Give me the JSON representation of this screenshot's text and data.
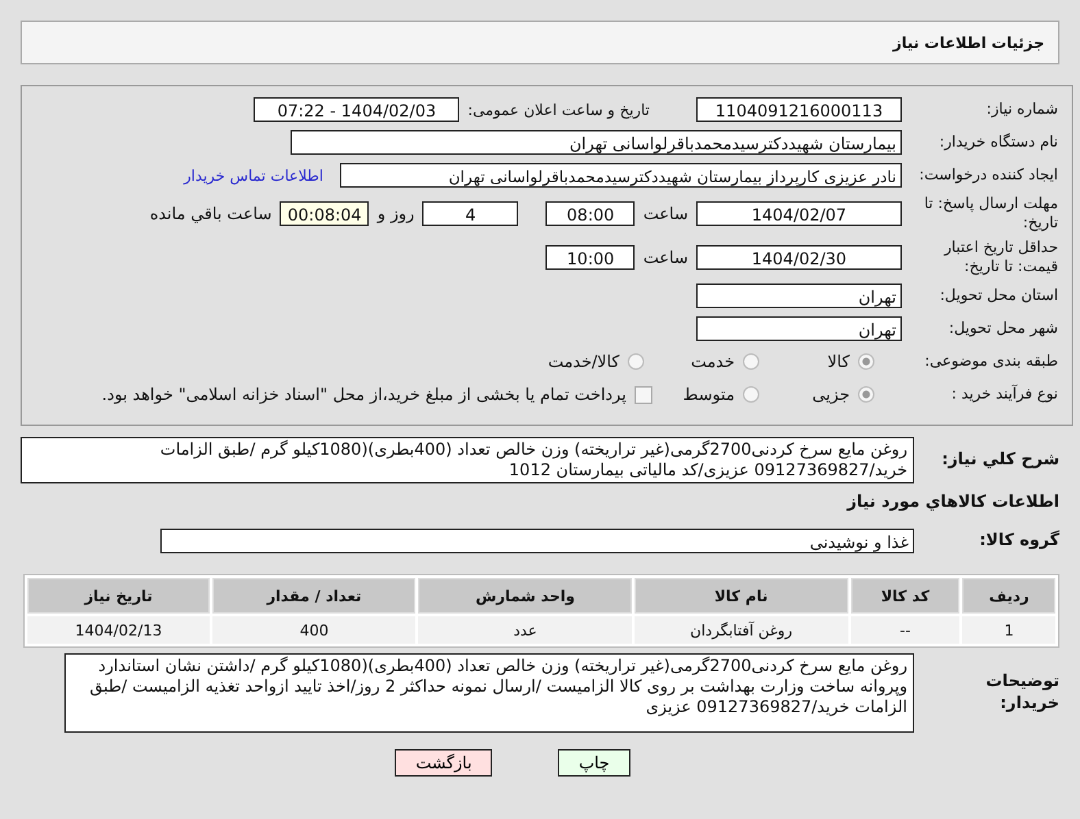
{
  "header": {
    "title": "جزئیات اطلاعات نیاز"
  },
  "form": {
    "need_number": {
      "label": "شماره نیاز:",
      "value": "1104091216000113"
    },
    "announce": {
      "label": "تاریخ و ساعت اعلان عمومی:",
      "value": "1404/02/03 - 07:22"
    },
    "buyer": {
      "label": "نام دستگاه خریدار:",
      "value": "بیمارستان شهیددکترسیدمحمدباقرلواسانی تهران"
    },
    "creator": {
      "label": "ایجاد کننده درخواست:",
      "value": "نادر  عزیزی کارپرداز بیمارستان شهیددکترسیدمحمدباقرلواسانی تهران",
      "link": "اطلاعات تماس خریدار"
    },
    "deadline": {
      "label": "مهلت ارسال پاسخ: تا تاریخ:",
      "date": "1404/02/07",
      "time_label": "ساعت",
      "time": "08:00",
      "days": "4",
      "days_label": "روز و",
      "remaining": "00:08:04",
      "remaining_label": "ساعت باقي مانده"
    },
    "validity": {
      "label": "حداقل تاریخ اعتبار قیمت: تا تاریخ:",
      "date": "1404/02/30",
      "time_label": "ساعت",
      "time": "10:00"
    },
    "province": {
      "label": "استان محل تحویل:",
      "value": "تهران"
    },
    "city": {
      "label": "شهر محل تحویل:",
      "value": "تهران"
    },
    "category": {
      "label": "طبقه بندی موضوعی:",
      "options": [
        {
          "label": "کالا",
          "selected": true
        },
        {
          "label": "خدمت",
          "selected": false
        },
        {
          "label": "کالا/خدمت",
          "selected": false
        }
      ]
    },
    "process": {
      "label": "نوع فرآیند خرید :",
      "options": [
        {
          "label": "جزیی",
          "selected": true
        },
        {
          "label": "متوسط",
          "selected": false
        }
      ],
      "payment": {
        "label": "پرداخت تمام یا بخشی از مبلغ خرید،از محل \"اسناد خزانه اسلامی\" خواهد بود.",
        "checked": false
      }
    }
  },
  "summary": {
    "label": "شرح كلي نياز:",
    "value": "روغن مایع سرخ کردنی2700گرمی(غیر تراریخته) وزن خالص تعداد (400بطری)(1080کیلو گرم /طبق الزامات خرید/09127369827 عزیزی/کد مالیاتی بیمارستان 1012"
  },
  "goods_title": "اطلاعات كالاهاي مورد نياز",
  "group": {
    "label": "گروه کالا:",
    "value": "غذا و نوشیدنی"
  },
  "table": {
    "columns": [
      "ردیف",
      "کد کالا",
      "نام کالا",
      "واحد شمارش",
      "تعداد / مقدار",
      "تاریخ نیاز"
    ],
    "rows": [
      [
        "1",
        "--",
        "روغن آفتابگردان",
        "عدد",
        "400",
        "1404/02/13"
      ]
    ]
  },
  "notes": {
    "label": "توضیحات خریدار:",
    "value": "روغن مایع سرخ کردنی2700گرمی(غیر تراریخته) وزن خالص تعداد (400بطری)(1080کیلو گرم /داشتن نشان استاندارد وپروانه ساخت وزارت بهداشت بر روی کالا الزامیست /ارسال نمونه حداکثر 2 روز/اخذ تایید ازواحد تغذیه الزامیست /طبق الزامات خرید/09127369827 عزیزی"
  },
  "buttons": [
    {
      "label": "چاپ",
      "kind": "print"
    },
    {
      "label": "بازگشت",
      "kind": "back"
    }
  ]
}
